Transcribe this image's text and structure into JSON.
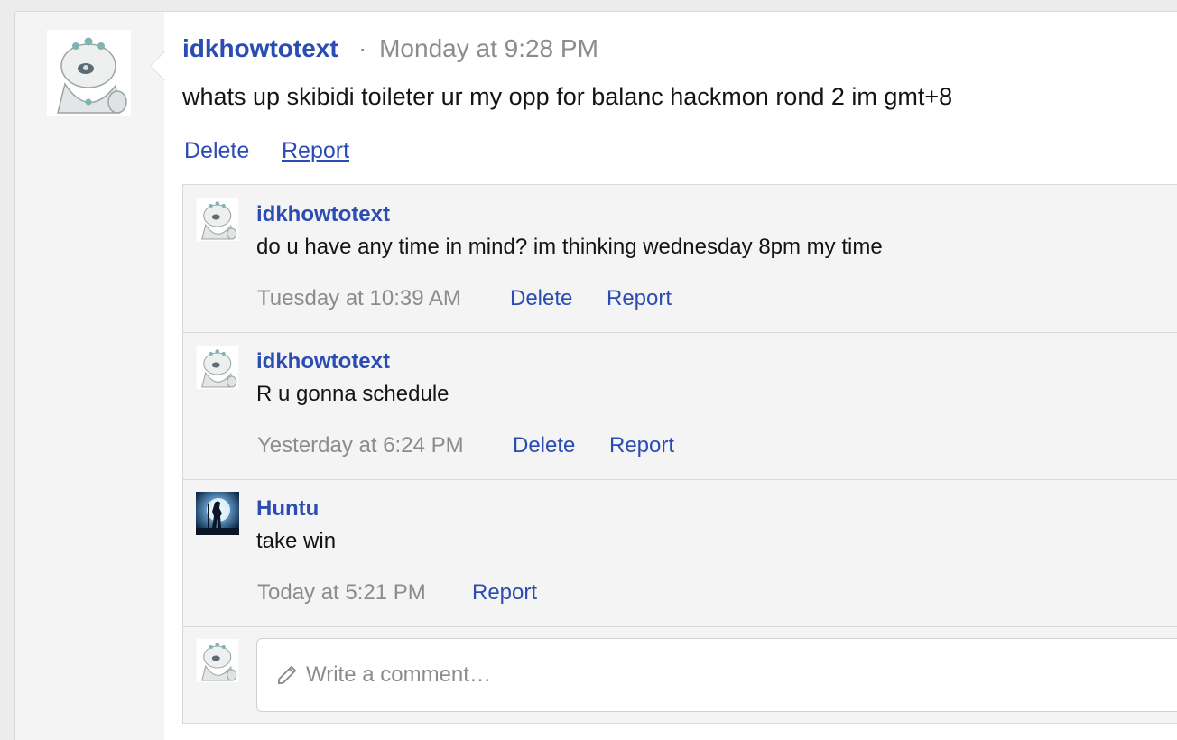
{
  "post": {
    "author": "idkhowtotext",
    "separator": "·",
    "time": "Monday at 9:28 PM",
    "body": "whats up skibidi toileter ur my opp for balanc hackmon rond 2 im gmt+8",
    "actions": {
      "delete": "Delete",
      "report": "Report"
    }
  },
  "comments": [
    {
      "author": "idkhowtotext",
      "body": "do u have any time in mind? im thinking wednesday 8pm my time",
      "time": "Tuesday at 10:39 AM",
      "delete": "Delete",
      "report": "Report"
    },
    {
      "author": "idkhowtotext",
      "body": "R u gonna schedule",
      "time": "Yesterday at 6:24 PM",
      "delete": "Delete",
      "report": "Report"
    },
    {
      "author": "Huntu",
      "body": "take win",
      "time": "Today at 5:21 PM",
      "report": "Report"
    }
  ],
  "composer": {
    "placeholder": "Write a comment…",
    "icon": "pencil-icon"
  },
  "colors": {
    "link": "#2a4cb3",
    "muted": "#8c8c8c",
    "panel": "#f4f4f4",
    "border": "#d8d8d8"
  }
}
